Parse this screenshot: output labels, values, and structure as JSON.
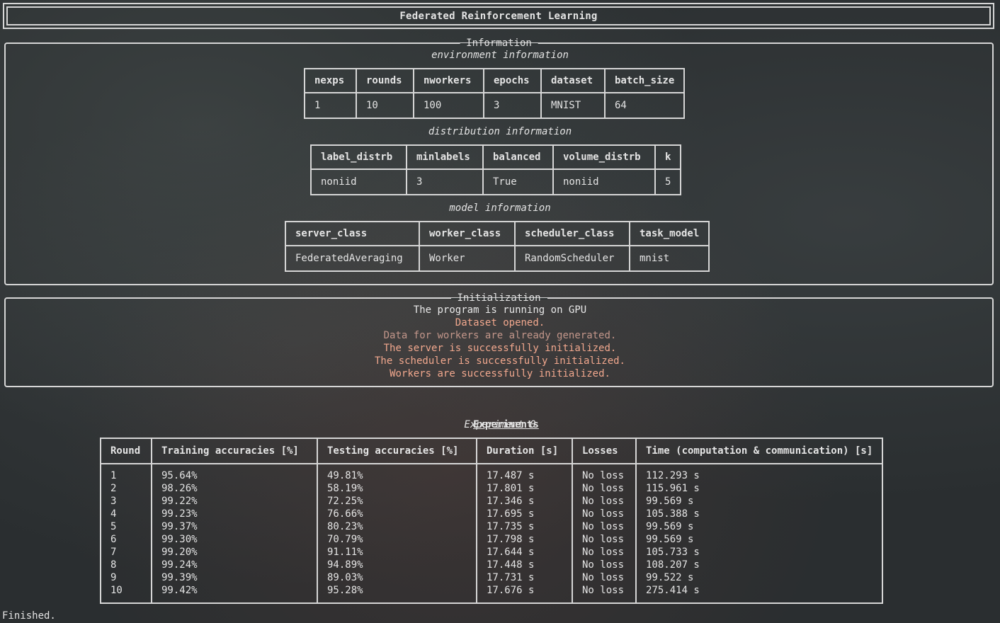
{
  "title": "Federated Reinforcement Learning",
  "information": {
    "panel_title": "Information",
    "environment": {
      "caption": "environment information",
      "headers": [
        "nexps",
        "rounds",
        "nworkers",
        "epochs",
        "dataset",
        "batch_size"
      ],
      "values": [
        "1",
        "10",
        "100",
        "3",
        "MNIST",
        "64"
      ]
    },
    "distribution": {
      "caption": "distribution information",
      "headers": [
        "label_distrb",
        "minlabels",
        "balanced",
        "volume_distrb",
        "k"
      ],
      "values": [
        "noniid",
        "3",
        "True",
        "noniid",
        "5"
      ]
    },
    "model": {
      "caption": "model information",
      "headers": [
        "server_class",
        "worker_class",
        "scheduler_class",
        "task_model"
      ],
      "values": [
        "FederatedAveraging",
        "Worker",
        "RandomScheduler",
        "mnist"
      ]
    }
  },
  "initialization": {
    "panel_title": "Initialization",
    "lines": [
      "The program is running on GPU",
      "Dataset opened.",
      "Data for workers are already generated.",
      "The server is successfully initialized.",
      "The scheduler is successfully initialized.",
      "Workers are successfully initialized."
    ]
  },
  "experiments": {
    "heading": "Experiments",
    "subheading": "Experiment 0",
    "headers": [
      "Round",
      "Training accuracies [%]",
      "Testing accuracies [%]",
      "Duration [s]",
      "Losses",
      "Time (computation & communication) [s]"
    ],
    "rows": [
      [
        "1",
        "95.64%",
        "49.81%",
        "17.487 s",
        "No loss",
        "112.293 s"
      ],
      [
        "2",
        "98.26%",
        "58.19%",
        "17.801 s",
        "No loss",
        "115.961 s"
      ],
      [
        "3",
        "99.22%",
        "72.25%",
        "17.346 s",
        "No loss",
        "99.569 s"
      ],
      [
        "4",
        "99.23%",
        "76.66%",
        "17.695 s",
        "No loss",
        "105.388 s"
      ],
      [
        "5",
        "99.37%",
        "80.23%",
        "17.735 s",
        "No loss",
        "99.569 s"
      ],
      [
        "6",
        "99.30%",
        "70.79%",
        "17.798 s",
        "No loss",
        "99.569 s"
      ],
      [
        "7",
        "99.20%",
        "91.11%",
        "17.644 s",
        "No loss",
        "105.733 s"
      ],
      [
        "8",
        "99.24%",
        "94.89%",
        "17.448 s",
        "No loss",
        "108.207 s"
      ],
      [
        "9",
        "99.39%",
        "89.03%",
        "17.731 s",
        "No loss",
        "99.522 s"
      ],
      [
        "10",
        "99.42%",
        "95.28%",
        "17.676 s",
        "No loss",
        "275.414 s"
      ]
    ]
  },
  "status": "Finished.",
  "colors": {
    "background": "#2a2e30",
    "text": "#e4e4e4",
    "border": "#d6d6d6",
    "init_highlight": "#f2a88e"
  }
}
